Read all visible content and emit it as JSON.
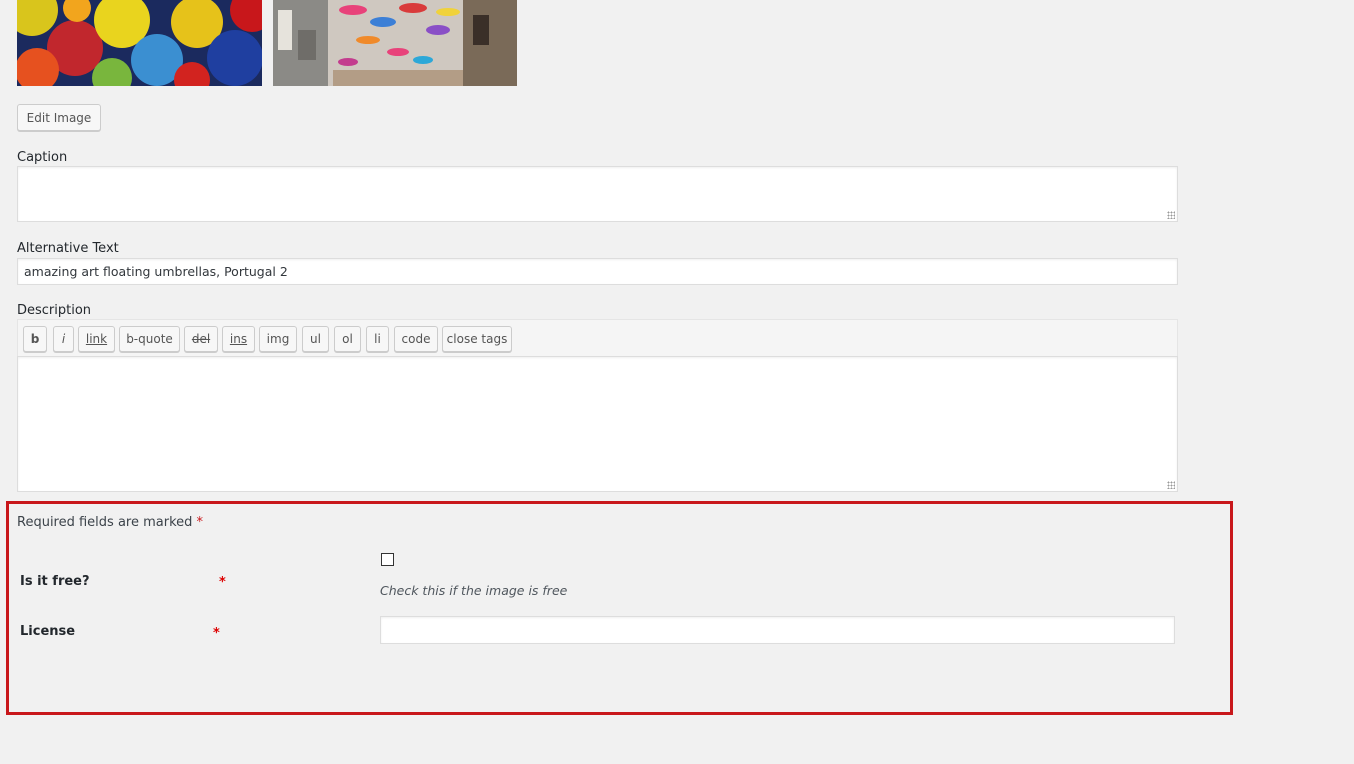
{
  "media": {
    "thumbnails": [
      {
        "name": "umbrellas-thumbnail-1"
      },
      {
        "name": "umbrellas-thumbnail-2"
      }
    ],
    "edit_image_label": "Edit Image"
  },
  "form": {
    "caption": {
      "label": "Caption",
      "value": ""
    },
    "alt_text": {
      "label": "Alternative Text",
      "value": "amazing art floating umbrellas, Portugal 2"
    },
    "description": {
      "label": "Description",
      "value": "",
      "toolbar": [
        "b",
        "i",
        "link",
        "b-quote",
        "del",
        "ins",
        "img",
        "ul",
        "ol",
        "li",
        "code",
        "close tags"
      ]
    }
  },
  "required_section": {
    "note": "Required fields are marked",
    "star": "*",
    "fields": [
      {
        "label": "Is it free?",
        "star": "*",
        "type": "checkbox",
        "checked": false,
        "hint": "Check this if the image is free"
      },
      {
        "label": "License",
        "star": "*",
        "type": "text",
        "value": ""
      }
    ]
  },
  "colors": {
    "highlight_border": "#c8171b",
    "required_star": "#d00000"
  }
}
